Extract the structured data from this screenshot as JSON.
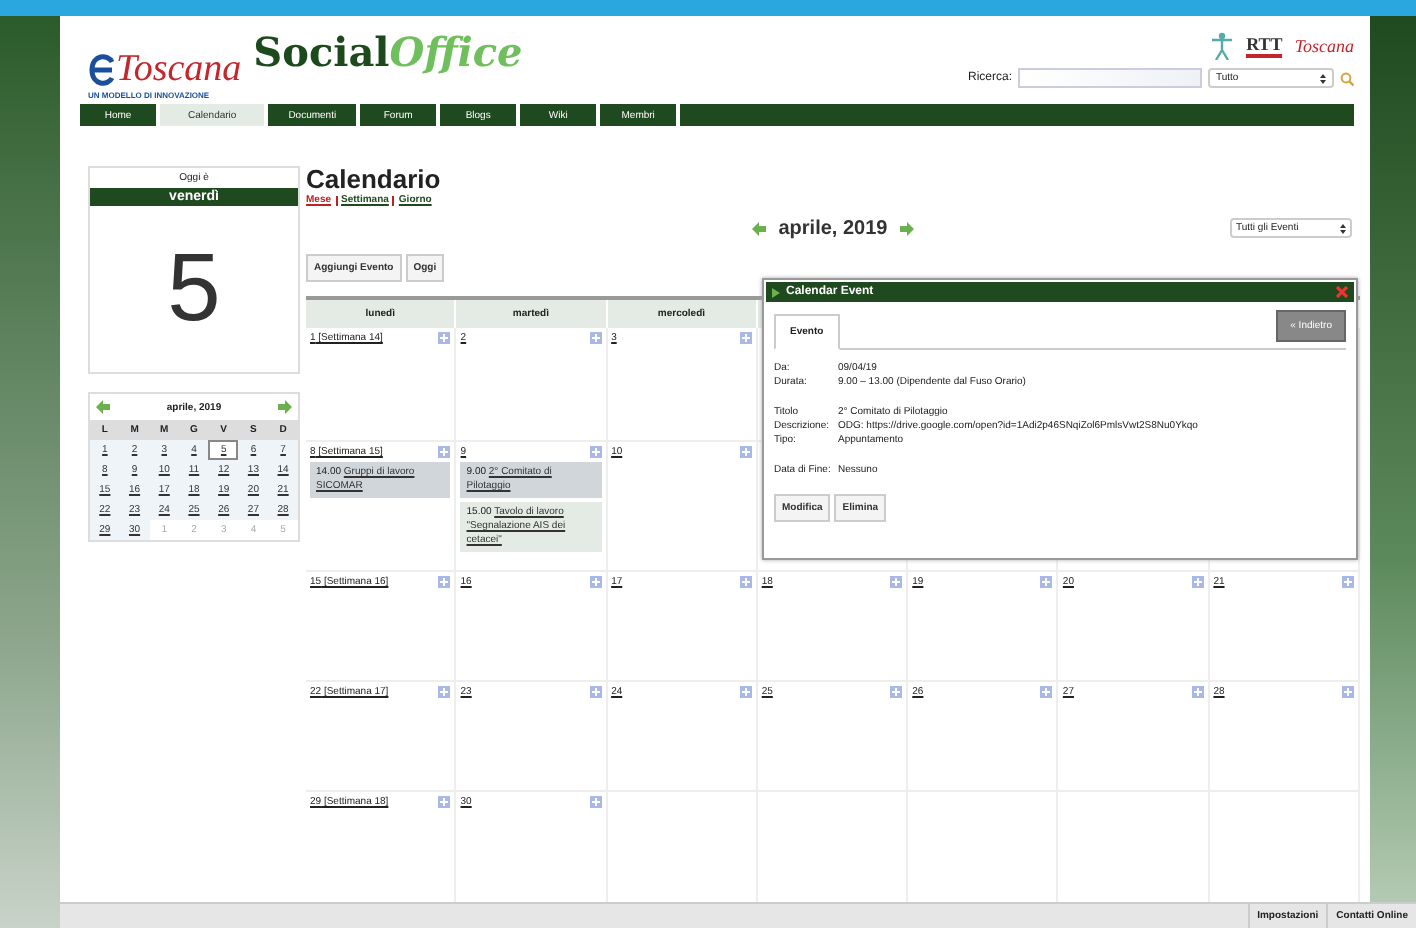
{
  "brand": {
    "part_1": "Social",
    "part_2": "Office",
    "logo_word": "Toscana",
    "tagline": "UN MODELLO DI INNOVAZIONE",
    "partner_logo": "RTT",
    "partner_logo_2": "Toscana"
  },
  "search": {
    "label": "Ricerca:",
    "scope": "Tutto"
  },
  "nav": [
    {
      "label": "Home",
      "selected": false
    },
    {
      "label": "Calendario",
      "selected": true
    },
    {
      "label": "Documenti",
      "selected": false
    },
    {
      "label": "Forum",
      "selected": false
    },
    {
      "label": "Blogs",
      "selected": false
    },
    {
      "label": "Wiki",
      "selected": false
    },
    {
      "label": "Membri",
      "selected": false
    }
  ],
  "today": {
    "caption": "Oggi è",
    "weekday": "venerdì",
    "day": "5"
  },
  "mini_calendar": {
    "title": "aprile, 2019",
    "weekdays": [
      "L",
      "M",
      "M",
      "G",
      "V",
      "S",
      "D"
    ],
    "days": [
      {
        "label": "1",
        "selected": false,
        "other_month": false
      },
      {
        "label": "2",
        "selected": false,
        "other_month": false
      },
      {
        "label": "3",
        "selected": false,
        "other_month": false
      },
      {
        "label": "4",
        "selected": false,
        "other_month": false
      },
      {
        "label": "5",
        "selected": true,
        "other_month": false
      },
      {
        "label": "6",
        "selected": false,
        "other_month": false
      },
      {
        "label": "7",
        "selected": false,
        "other_month": false
      },
      {
        "label": "8",
        "selected": false,
        "other_month": false
      },
      {
        "label": "9",
        "selected": false,
        "other_month": false
      },
      {
        "label": "10",
        "selected": false,
        "other_month": false
      },
      {
        "label": "11",
        "selected": false,
        "other_month": false
      },
      {
        "label": "12",
        "selected": false,
        "other_month": false
      },
      {
        "label": "13",
        "selected": false,
        "other_month": false
      },
      {
        "label": "14",
        "selected": false,
        "other_month": false
      },
      {
        "label": "15",
        "selected": false,
        "other_month": false
      },
      {
        "label": "16",
        "selected": false,
        "other_month": false
      },
      {
        "label": "17",
        "selected": false,
        "other_month": false
      },
      {
        "label": "18",
        "selected": false,
        "other_month": false
      },
      {
        "label": "19",
        "selected": false,
        "other_month": false
      },
      {
        "label": "20",
        "selected": false,
        "other_month": false
      },
      {
        "label": "21",
        "selected": false,
        "other_month": false
      },
      {
        "label": "22",
        "selected": false,
        "other_month": false
      },
      {
        "label": "23",
        "selected": false,
        "other_month": false
      },
      {
        "label": "24",
        "selected": false,
        "other_month": false
      },
      {
        "label": "25",
        "selected": false,
        "other_month": false
      },
      {
        "label": "26",
        "selected": false,
        "other_month": false
      },
      {
        "label": "27",
        "selected": false,
        "other_month": false
      },
      {
        "label": "28",
        "selected": false,
        "other_month": false
      },
      {
        "label": "29",
        "selected": false,
        "other_month": false
      },
      {
        "label": "30",
        "selected": false,
        "other_month": false
      },
      {
        "label": "1",
        "selected": false,
        "other_month": true
      },
      {
        "label": "2",
        "selected": false,
        "other_month": true
      },
      {
        "label": "3",
        "selected": false,
        "other_month": true
      },
      {
        "label": "4",
        "selected": false,
        "other_month": true
      },
      {
        "label": "5",
        "selected": false,
        "other_month": true
      }
    ]
  },
  "page_title": "Calendario",
  "views": [
    {
      "label": "Mese",
      "selected": true
    },
    {
      "label": "Settimana",
      "selected": false
    },
    {
      "label": "Giorno",
      "selected": false
    }
  ],
  "month_title": "aprile, 2019",
  "filter": "Tutti gli Eventi",
  "actions": [
    "Aggiungi Evento",
    "Oggi"
  ],
  "columns": [
    "lunedì",
    "martedì",
    "mercoledì"
  ],
  "weeks": [
    {
      "cells": [
        {
          "day": "1",
          "week": "[Settimana 14]"
        },
        {
          "day": "2"
        },
        {
          "day": "3"
        }
      ]
    },
    {
      "cells": [
        {
          "day": "8",
          "week": "[Settimana 15]",
          "events": [
            {
              "time": "14.00",
              "title": "Gruppi di lavoro SICOMAR",
              "selected": true
            }
          ]
        },
        {
          "day": "9",
          "events": [
            {
              "time": "9.00",
              "title": "2° Comitato di Pilotaggio",
              "selected": true
            },
            {
              "time": "15.00",
              "title": "Tavolo di lavoro \"Segnalazione AIS dei cetacei\"",
              "selected": false
            }
          ]
        },
        {
          "day": "10"
        }
      ]
    },
    {
      "cells": [
        {
          "day": "15",
          "week": "[Settimana 16]"
        },
        {
          "day": "16"
        },
        {
          "day": "17"
        },
        {
          "day": "18"
        },
        {
          "day": "19"
        },
        {
          "day": "20"
        },
        {
          "day": "21"
        }
      ]
    },
    {
      "cells": [
        {
          "day": "22",
          "week": "[Settimana 17]"
        },
        {
          "day": "23"
        },
        {
          "day": "24"
        },
        {
          "day": "25"
        },
        {
          "day": "26"
        },
        {
          "day": "27"
        },
        {
          "day": "28"
        }
      ]
    },
    {
      "cells": [
        {
          "day": "29",
          "week": "[Settimana 18]"
        },
        {
          "day": "30"
        }
      ]
    }
  ],
  "popup": {
    "title": "Calendar Event",
    "tab": "Evento",
    "back": "« Indietro",
    "field_groups": [
      [
        {
          "label": "Da:",
          "value": "09/04/19"
        },
        {
          "label": "Durata:",
          "value": "9.00 – 13.00 (Dipendente dal Fuso Orario)"
        }
      ],
      [
        {
          "label": "Titolo",
          "value": "2° Comitato di Pilotaggio"
        },
        {
          "label": "Descrizione:",
          "value": "ODG: https://drive.google.com/open?id=1Adi2p46SNqiZol6PmlsVwt2S8Nu0Ykqo"
        },
        {
          "label": "Tipo:",
          "value": "Appuntamento"
        }
      ],
      [
        {
          "label": "Data di Fine:",
          "value": "Nessuno"
        }
      ]
    ],
    "buttons": [
      "Modifica",
      "Elimina"
    ]
  },
  "footer": [
    "Impostazioni",
    "Contatti Online"
  ]
}
